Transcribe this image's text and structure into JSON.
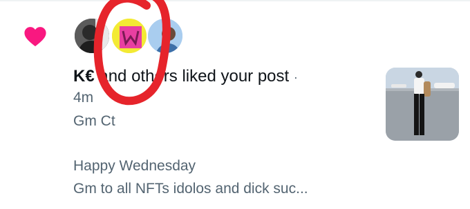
{
  "notification": {
    "icon": "heart-icon",
    "icon_color": "#f91880",
    "avatars": [
      "avatar-person",
      "avatar-w-logo",
      "avatar-profile"
    ],
    "actor_name": "K€",
    "summary_mid": "and",
    "summary_rest": "others liked your post",
    "summary_dot": "·",
    "time": "4m",
    "source_label": "Gm Ct",
    "post_text_line1": "Happy Wednesday",
    "post_text_line2": "Gm to all NFTs idolos and dick suc...",
    "annotation_color": "#e6242b"
  }
}
